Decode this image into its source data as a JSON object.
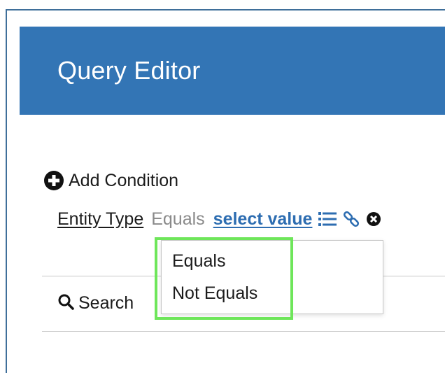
{
  "header": {
    "title": "Query Editor"
  },
  "toolbar": {
    "add_condition_label": "Add Condition"
  },
  "condition": {
    "field_label": "Entity Type",
    "operator_label": "Equals",
    "value_placeholder": "select value",
    "icons": [
      "list-icon",
      "link-icon",
      "remove-circle-icon"
    ]
  },
  "dropdown": {
    "options": [
      "Equals",
      "Not Equals"
    ]
  },
  "search": {
    "label": "Search"
  },
  "colors": {
    "header_bg": "#3375b5",
    "link": "#2d6db1",
    "highlight": "#6ee65a"
  }
}
